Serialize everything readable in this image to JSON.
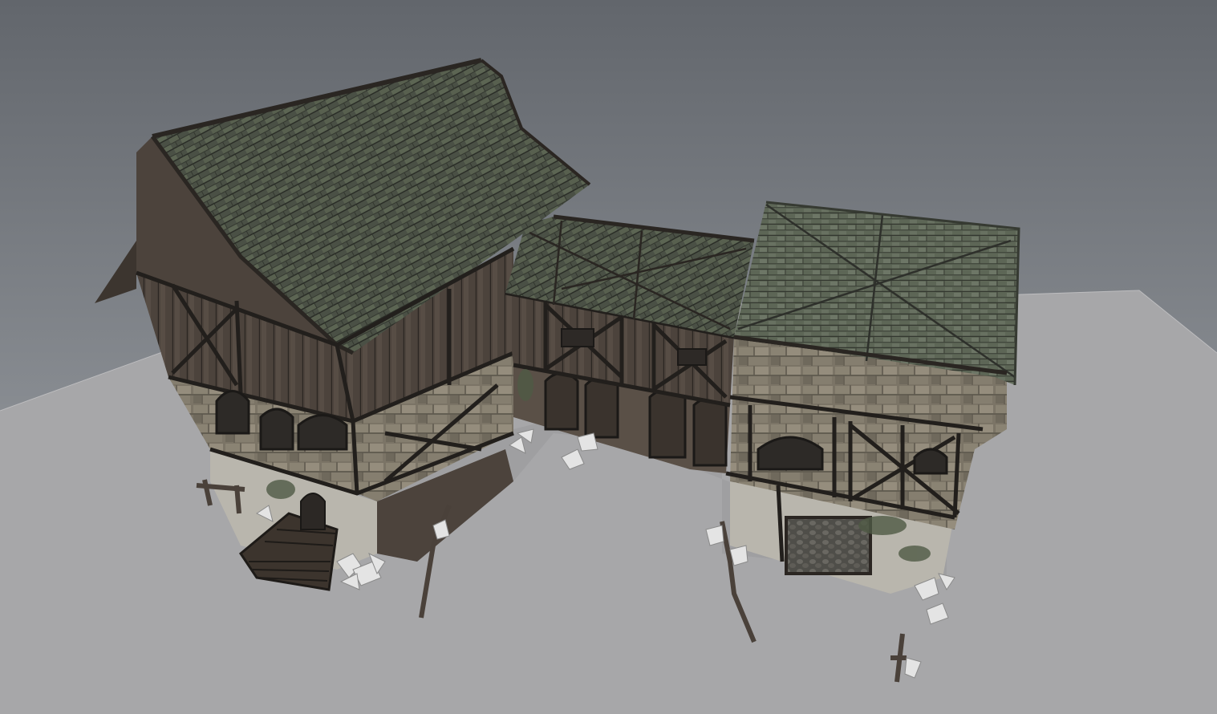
{
  "viewport": {
    "background_top": "#62666c",
    "background_bottom": "#a4a8ad",
    "ground_color": "#a7a7a9"
  },
  "model": {
    "roof_color": "#4a5045",
    "roof_highlight": "#6b7466",
    "wood_color": "#4c433c",
    "wood_dark": "#2b2622",
    "stone_color": "#7b7466",
    "stone_light": "#958d7d",
    "wireframe_color": "#1e1d1b",
    "foliage_color": "#e4e4e4"
  }
}
